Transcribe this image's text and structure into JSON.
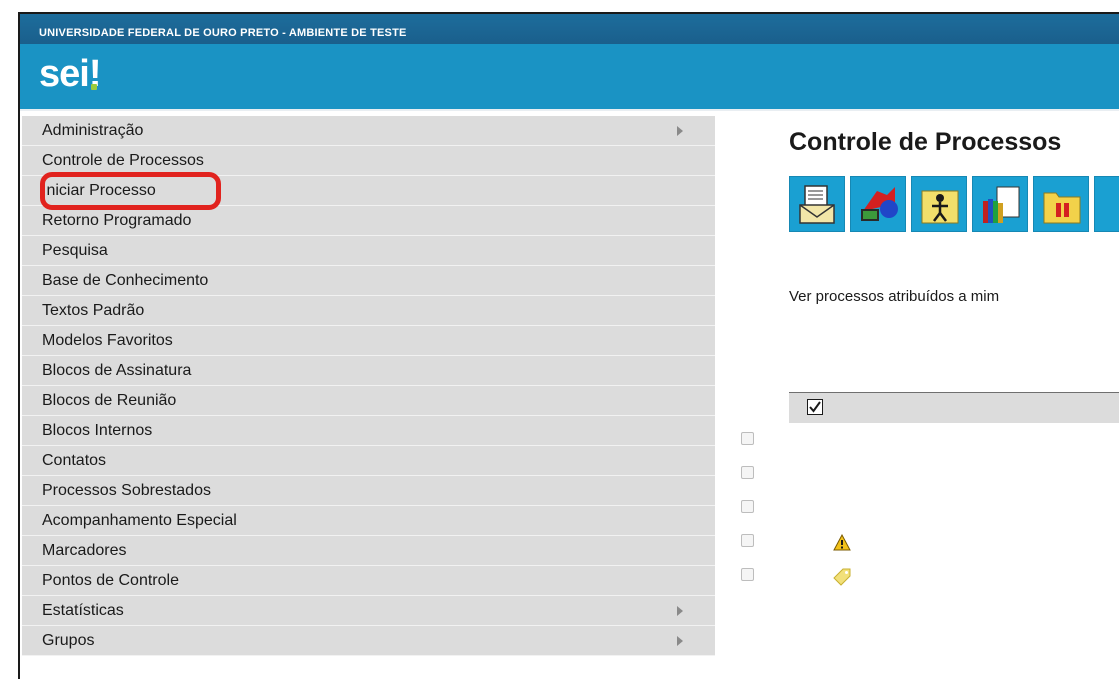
{
  "header": {
    "org_name": "UNIVERSIDADE FEDERAL DE OURO PRETO - AMBIENTE DE TESTE",
    "logo_text": "sei",
    "logo_bang": "!"
  },
  "sidebar": {
    "items": [
      {
        "label": "Administração",
        "has_submenu": true
      },
      {
        "label": "Controle de Processos",
        "has_submenu": false
      },
      {
        "label": "Iniciar Processo",
        "has_submenu": false,
        "highlighted": true
      },
      {
        "label": "Retorno Programado",
        "has_submenu": false
      },
      {
        "label": "Pesquisa",
        "has_submenu": false
      },
      {
        "label": "Base de Conhecimento",
        "has_submenu": false
      },
      {
        "label": "Textos Padrão",
        "has_submenu": false
      },
      {
        "label": "Modelos Favoritos",
        "has_submenu": false
      },
      {
        "label": "Blocos de Assinatura",
        "has_submenu": false
      },
      {
        "label": "Blocos de Reunião",
        "has_submenu": false
      },
      {
        "label": "Blocos Internos",
        "has_submenu": false
      },
      {
        "label": "Contatos",
        "has_submenu": false
      },
      {
        "label": "Processos Sobrestados",
        "has_submenu": false
      },
      {
        "label": "Acompanhamento Especial",
        "has_submenu": false
      },
      {
        "label": "Marcadores",
        "has_submenu": false
      },
      {
        "label": "Pontos de Controle",
        "has_submenu": false
      },
      {
        "label": "Estatísticas",
        "has_submenu": true
      },
      {
        "label": "Grupos",
        "has_submenu": true
      }
    ]
  },
  "main": {
    "title": "Controle de Processos",
    "toolbar_icons": [
      "envelope-document-icon",
      "network-computer-icon",
      "person-folder-icon",
      "books-document-icon",
      "pause-folder-icon"
    ],
    "assigned_link": "Ver processos atribuídos a mim",
    "rows_icons": [
      "",
      "",
      "",
      "warning-icon",
      "tag-icon"
    ]
  },
  "colors": {
    "header_blue": "#1a93c4",
    "header_strip": "#1d6d9c",
    "menu_bg": "#dcdcdc",
    "highlight_red": "#e1231e",
    "toolbar_blue": "#1aa0d2"
  }
}
